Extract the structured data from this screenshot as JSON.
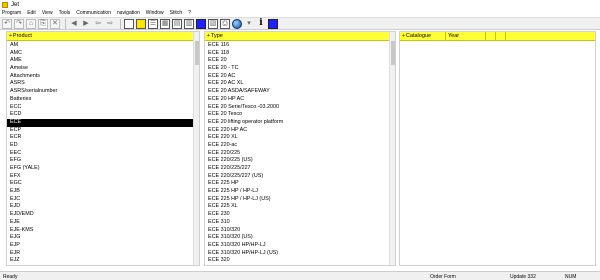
{
  "window": {
    "title": "Jet"
  },
  "menu": [
    "Program",
    "Edit",
    "View",
    "Tools",
    "Communication",
    "navigation",
    "Window",
    "Stitch",
    "?"
  ],
  "toolbar": {
    "icons": [
      "back-icon",
      "forward-icon",
      "home-icon",
      "open-icon",
      "close-icon",
      "nav-left-icon",
      "nav-right-icon",
      "nav-prev-icon",
      "nav-next-icon"
    ]
  },
  "product_pane": {
    "header": "Product",
    "items": [
      "AM",
      "AMC",
      "AME",
      "Ameise",
      "Attachments",
      "ASRS",
      "ASRS/serialnumber",
      "Batteries",
      "ECC",
      "ECD",
      "ECE",
      "ECP",
      "ECR",
      "ED",
      "EEC",
      "EFG",
      "EFG (YALE)",
      "EFX",
      "EGC",
      "EJB",
      "EJC",
      "EJD",
      "EJD/EMD",
      "EJE",
      "EJE-KMS",
      "EJG",
      "EJP",
      "EJR",
      "EJZ",
      "EKS"
    ],
    "selected": "ECE"
  },
  "type_pane": {
    "header": "Type",
    "items": [
      "ECE 116",
      "ECE 118",
      "ECE 20",
      "ECE 20 - TC",
      "ECE 20 AC",
      "ECE 20 AC XL",
      "ECE 20 ASDA/SAFEWAY",
      "ECE 20 HP AC",
      "ECE 20 Serie/Tesco -03.2000",
      "ECE 20 Tesco",
      "ECE 20 lifting operator platform",
      "ECE 220 HP AC",
      "ECE 220 XL",
      "ECE 220-ac",
      "ECE 220/225",
      "ECE 220/225 (US)",
      "ECE 220/225/227",
      "ECE 220/225/227 (US)",
      "ECE 225 HP",
      "ECE 225 HP / HP-LJ",
      "ECE 225 HP / HP-LJ (US)",
      "ECE 225 XL",
      "ECE 230",
      "ECE 310",
      "ECE 310/320",
      "ECE 310/320 (US)",
      "ECE 310/320 HP/HP-LJ",
      "ECE 310/320 HP/HP-LJ (US)",
      "ECE 320"
    ]
  },
  "catalogue_pane": {
    "headers": [
      "Catalogue",
      "Year"
    ]
  },
  "status": {
    "left": "Ready",
    "mid": "Order Form",
    "update": "Update 332",
    "num": "NUM"
  }
}
